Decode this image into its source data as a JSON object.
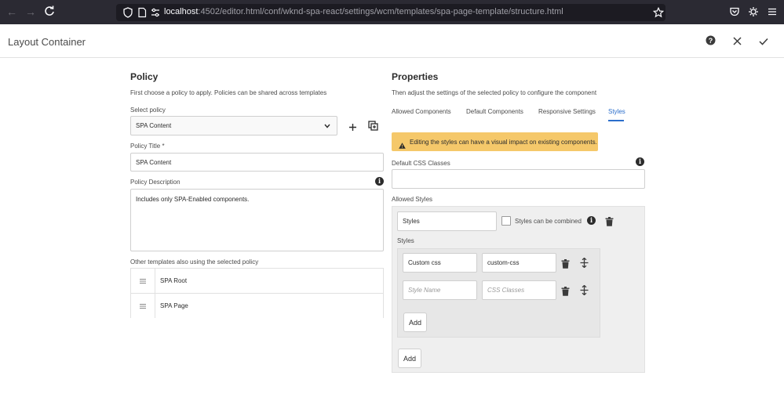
{
  "browser": {
    "url_host": "localhost",
    "url_rest": ":4502/editor.html/conf/wknd-spa-react/settings/wcm/templates/spa-page-template/structure.html"
  },
  "dialog": {
    "title": "Layout Container"
  },
  "policy": {
    "heading": "Policy",
    "intro": "First choose a policy to apply. Policies can be shared across templates",
    "select_label": "Select policy",
    "select_value": "SPA Content",
    "title_label": "Policy Title *",
    "title_value": "SPA Content",
    "description_label": "Policy Description",
    "description_value": "Includes only SPA-Enabled components.",
    "other_templates_label": "Other templates also using the selected policy",
    "other_templates": [
      "SPA Root",
      "SPA Page"
    ]
  },
  "properties": {
    "heading": "Properties",
    "intro": "Then adjust the settings of the selected policy to configure the component",
    "tabs": [
      {
        "label": "Allowed Components"
      },
      {
        "label": "Default Components"
      },
      {
        "label": "Responsive Settings"
      },
      {
        "label": "Styles"
      }
    ],
    "alert": "Editing the styles can have a visual impact on existing components.",
    "default_css_label": "Default CSS Classes",
    "default_css_value": "",
    "allowed_styles_label": "Allowed Styles",
    "group_name_value": "Styles",
    "combined_label": "Styles can be combined",
    "styles_label": "Styles",
    "style_rows": [
      {
        "name": "Custom css",
        "css": "custom-css"
      }
    ],
    "style_name_placeholder": "Style Name",
    "css_classes_placeholder": "CSS Classes",
    "add_style_label": "Add",
    "add_group_label": "Add"
  }
}
